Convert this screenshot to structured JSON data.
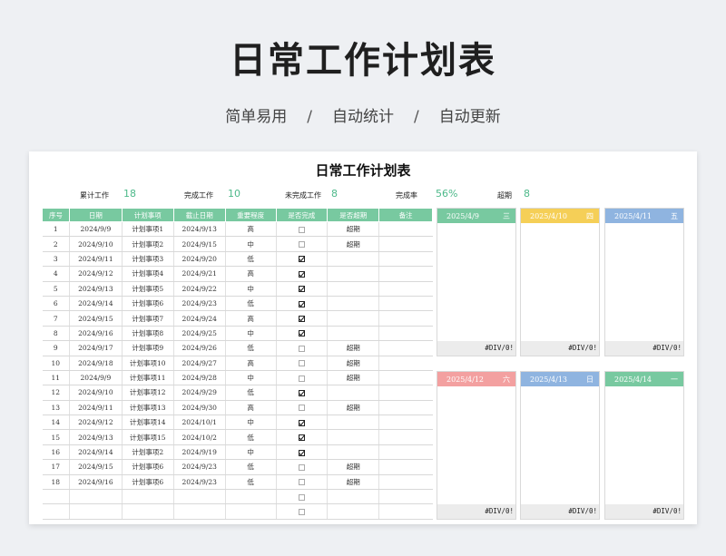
{
  "hero": {
    "title": "日常工作计划表",
    "sub1": "简单易用",
    "sub2": "自动统计",
    "sub3": "自动更新",
    "sep": "/"
  },
  "sheet": {
    "title": "日常工作计划表",
    "stats": [
      {
        "label": "累计工作",
        "value": "18"
      },
      {
        "label": "完成工作",
        "value": "10"
      },
      {
        "label": "未完成工作",
        "value": "8"
      },
      {
        "label": "完成率",
        "value": "56%"
      },
      {
        "label": "超期",
        "value": "8"
      }
    ]
  },
  "table": {
    "headers": [
      "序号",
      "日期",
      "计划事项",
      "截止日期",
      "重要程度",
      "是否完成",
      "是否超期",
      "备注"
    ],
    "rows": [
      {
        "no": "1",
        "date": "2024/9/9",
        "item": "计划事项1",
        "due": "2024/9/13",
        "level": "高",
        "done": false,
        "over": "超期"
      },
      {
        "no": "2",
        "date": "2024/9/10",
        "item": "计划事项2",
        "due": "2024/9/15",
        "level": "中",
        "done": false,
        "over": "超期"
      },
      {
        "no": "3",
        "date": "2024/9/11",
        "item": "计划事项3",
        "due": "2024/9/20",
        "level": "低",
        "done": true,
        "over": ""
      },
      {
        "no": "4",
        "date": "2024/9/12",
        "item": "计划事项4",
        "due": "2024/9/21",
        "level": "高",
        "done": true,
        "over": ""
      },
      {
        "no": "5",
        "date": "2024/9/13",
        "item": "计划事项5",
        "due": "2024/9/22",
        "level": "中",
        "done": true,
        "over": ""
      },
      {
        "no": "6",
        "date": "2024/9/14",
        "item": "计划事项6",
        "due": "2024/9/23",
        "level": "低",
        "done": true,
        "over": ""
      },
      {
        "no": "7",
        "date": "2024/9/15",
        "item": "计划事项7",
        "due": "2024/9/24",
        "level": "高",
        "done": true,
        "over": ""
      },
      {
        "no": "8",
        "date": "2024/9/16",
        "item": "计划事项8",
        "due": "2024/9/25",
        "level": "中",
        "done": true,
        "over": ""
      },
      {
        "no": "9",
        "date": "2024/9/17",
        "item": "计划事项9",
        "due": "2024/9/26",
        "level": "低",
        "done": false,
        "over": "超期"
      },
      {
        "no": "10",
        "date": "2024/9/18",
        "item": "计划事项10",
        "due": "2024/9/27",
        "level": "高",
        "done": false,
        "over": "超期"
      },
      {
        "no": "11",
        "date": "2024/9/9",
        "item": "计划事项11",
        "due": "2024/9/28",
        "level": "中",
        "done": false,
        "over": "超期"
      },
      {
        "no": "12",
        "date": "2024/9/10",
        "item": "计划事项12",
        "due": "2024/9/29",
        "level": "低",
        "done": true,
        "over": ""
      },
      {
        "no": "13",
        "date": "2024/9/11",
        "item": "计划事项13",
        "due": "2024/9/30",
        "level": "高",
        "done": false,
        "over": "超期"
      },
      {
        "no": "14",
        "date": "2024/9/12",
        "item": "计划事项14",
        "due": "2024/10/1",
        "level": "中",
        "done": true,
        "over": ""
      },
      {
        "no": "15",
        "date": "2024/9/13",
        "item": "计划事项15",
        "due": "2024/10/2",
        "level": "低",
        "done": true,
        "over": ""
      },
      {
        "no": "16",
        "date": "2024/9/14",
        "item": "计划事项2",
        "due": "2024/9/19",
        "level": "中",
        "done": true,
        "over": ""
      },
      {
        "no": "17",
        "date": "2024/9/15",
        "item": "计划事项6",
        "due": "2024/9/23",
        "level": "低",
        "done": false,
        "over": "超期"
      },
      {
        "no": "18",
        "date": "2024/9/16",
        "item": "计划事项6",
        "due": "2024/9/23",
        "level": "低",
        "done": false,
        "over": "超期"
      },
      {
        "no": "",
        "date": "",
        "item": "",
        "due": "",
        "level": "",
        "done": false,
        "over": ""
      },
      {
        "no": "",
        "date": "",
        "item": "",
        "due": "",
        "level": "",
        "done": false,
        "over": ""
      }
    ]
  },
  "cards": [
    {
      "date": "2025/4/9",
      "weekday": "三",
      "footer": "#DIV/0!",
      "color": "#78c9a0"
    },
    {
      "date": "2025/4/10",
      "weekday": "四",
      "footer": "#DIV/0!",
      "color": "#f5cf57"
    },
    {
      "date": "2025/4/11",
      "weekday": "五",
      "footer": "#DIV/0!",
      "color": "#8fb4e0"
    },
    {
      "date": "2025/4/12",
      "weekday": "六",
      "footer": "#DIV/0!",
      "color": "#f3a0a0"
    },
    {
      "date": "2025/4/13",
      "weekday": "日",
      "footer": "#DIV/0!",
      "color": "#8fb4e0"
    },
    {
      "date": "2025/4/14",
      "weekday": "一",
      "footer": "#DIV/0!",
      "color": "#78c9a0"
    }
  ]
}
